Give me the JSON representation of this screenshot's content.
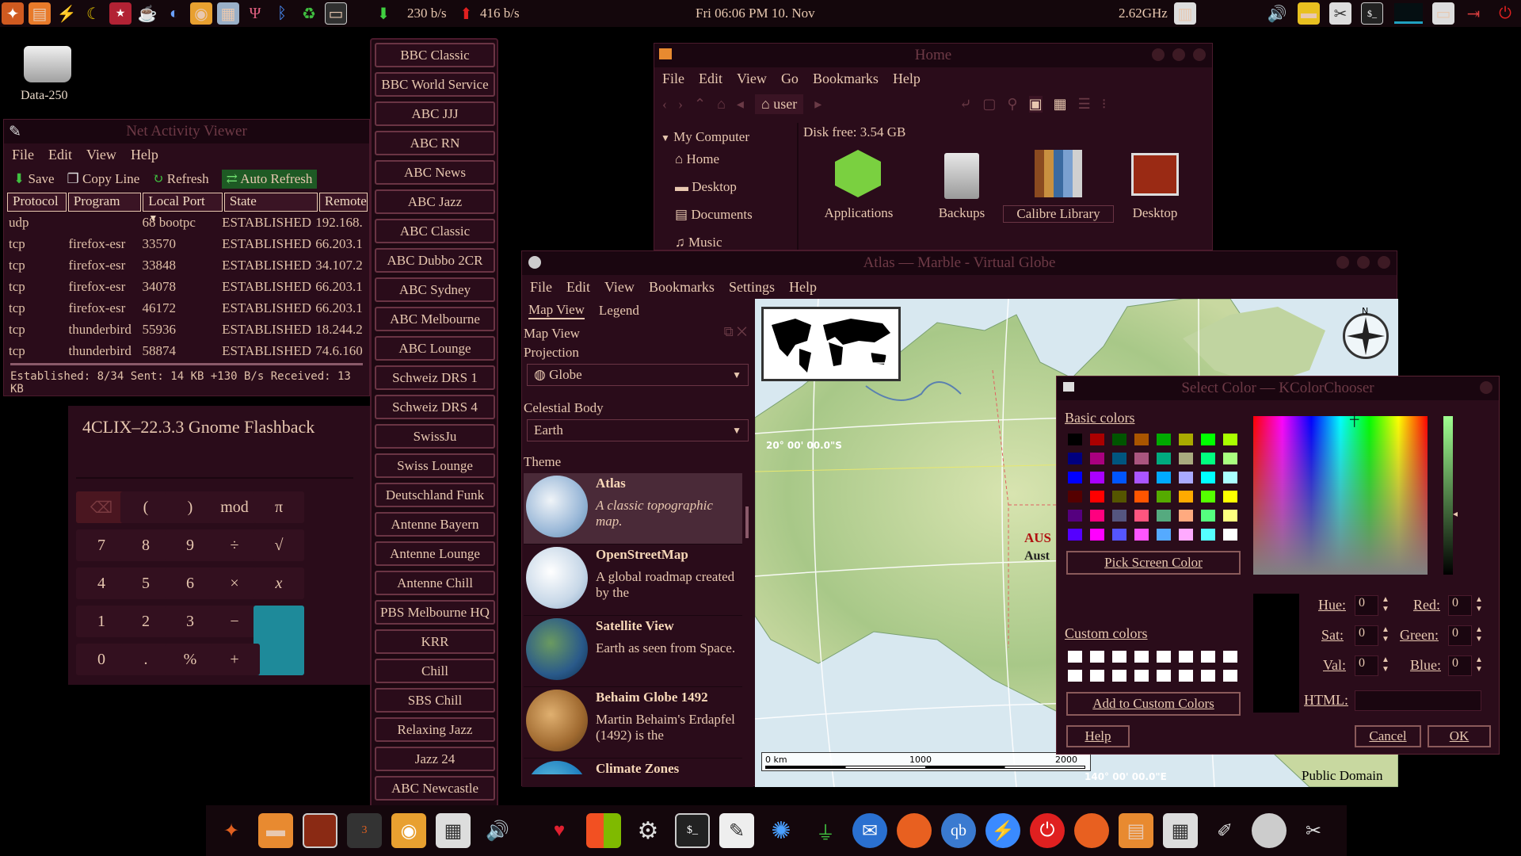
{
  "panel": {
    "net_down": "230 b/s",
    "net_up": "416 b/s",
    "clock": "Fri   06:06 PM  10. Nov",
    "cpu_freq": "2.62GHz"
  },
  "desktop": {
    "drive_label": "Data-250"
  },
  "net_viewer": {
    "title": "Net Activity Viewer",
    "menu": [
      "File",
      "Edit",
      "View",
      "Help"
    ],
    "toolbar": {
      "save": "Save",
      "copy_line": "Copy Line",
      "refresh": "Refresh",
      "auto_refresh": "Auto Refresh"
    },
    "columns": [
      "Protocol",
      "Program",
      "Local Port",
      "State",
      "Remote"
    ],
    "rows": [
      [
        "udp",
        "",
        "68 bootpc",
        "ESTABLISHED",
        "192.168."
      ],
      [
        "tcp",
        "firefox-esr",
        "33570",
        "ESTABLISHED",
        "66.203.1"
      ],
      [
        "tcp",
        "firefox-esr",
        "33848",
        "ESTABLISHED",
        "34.107.2"
      ],
      [
        "tcp",
        "firefox-esr",
        "34078",
        "ESTABLISHED",
        "66.203.1"
      ],
      [
        "tcp",
        "firefox-esr",
        "46172",
        "ESTABLISHED",
        "66.203.1"
      ],
      [
        "tcp",
        "thunderbird",
        "55936",
        "ESTABLISHED",
        "18.244.2"
      ],
      [
        "tcp",
        "thunderbird",
        "58874",
        "ESTABLISHED",
        "74.6.160"
      ]
    ],
    "status": "Established: 8/34  Sent: 14 KB +130 B/s    Received: 13 KB"
  },
  "calculator": {
    "display": "4CLIX–22.3.3 Gnome Flashback",
    "keys": [
      [
        "⌫",
        "(",
        ")",
        "mod",
        "π"
      ],
      [
        "7",
        "8",
        "9",
        "÷",
        "√"
      ],
      [
        "4",
        "5",
        "6",
        "×",
        "x"
      ],
      [
        "1",
        "2",
        "3",
        "−",
        "="
      ],
      [
        "0",
        ".",
        "%",
        "+"
      ]
    ]
  },
  "radio_stations": [
    "BBC Classic",
    "BBC World Service",
    "ABC JJJ",
    "ABC RN",
    "ABC News",
    "ABC Jazz",
    "ABC Classic",
    "ABC Dubbo 2CR",
    "ABC Sydney",
    "ABC Melbourne",
    "ABC Lounge",
    "Schweiz DRS 1",
    "Schweiz DRS 4",
    "SwissJu",
    "Swiss Lounge",
    "Deutschland Funk",
    "Antenne Bayern",
    "Antenne Lounge",
    "Antenne Chill",
    "PBS Melbourne HQ",
    "KRR",
    "Chill",
    "SBS Chill",
    "Relaxing Jazz",
    "Jazz 24",
    "ABC Newcastle"
  ],
  "home": {
    "title": "Home",
    "menu": [
      "File",
      "Edit",
      "View",
      "Go",
      "Bookmarks",
      "Help"
    ],
    "location": "user",
    "sidebar_header": "My Computer",
    "sidebar": [
      "Home",
      "Desktop",
      "Documents",
      "Music"
    ],
    "disk_free": "Disk free: 3.54 GB",
    "items": [
      "Applications",
      "Backups",
      "Calibre Library",
      "Desktop"
    ]
  },
  "marble": {
    "title": "Atlas — Marble - Virtual Globe",
    "menu": [
      "File",
      "Edit",
      "View",
      "Bookmarks",
      "Settings",
      "Help"
    ],
    "tabs": [
      "Map View",
      "Legend"
    ],
    "panel_title": "Map View",
    "projection_label": "Projection",
    "projection_value": "Globe",
    "body_label": "Celestial Body",
    "body_value": "Earth",
    "theme_label": "Theme",
    "themes": [
      {
        "name": "Atlas",
        "desc": "A classic topographic map."
      },
      {
        "name": "OpenStreetMap",
        "desc": "A global roadmap created by the"
      },
      {
        "name": "Satellite View",
        "desc": "Earth as seen from Space."
      },
      {
        "name": "Behaim Globe 1492",
        "desc": "Martin Behaim's Erdapfel (1492) is the"
      },
      {
        "name": "Climate Zones",
        "desc": ""
      }
    ],
    "lat_label": "20° 00' 00.0\"S",
    "lon_label": "140° 00' 00.0\"E",
    "place_label": "AUS",
    "place_label2": "Aust",
    "scale": [
      "0 km",
      "1000",
      "2000"
    ],
    "license": "Public Domain",
    "compass_n": "N"
  },
  "kcolor": {
    "title": "Select Color — KColorChooser",
    "basic_label": "Basic colors",
    "custom_label": "Custom colors",
    "pick_screen": "Pick Screen Color",
    "add_custom": "Add to Custom Colors",
    "help": "Help",
    "cancel": "Cancel",
    "ok": "OK",
    "hue_label": "Hue:",
    "sat_label": "Sat:",
    "val_label": "Val:",
    "red_label": "Red:",
    "green_label": "Green:",
    "blue_label": "Blue:",
    "html_label": "HTML:",
    "hue": "0",
    "sat": "0",
    "val": "0",
    "red": "0",
    "green": "0",
    "blue": "0",
    "basic_colors": [
      "#000000",
      "#aa0000",
      "#005500",
      "#aa5500",
      "#00aa00",
      "#aaaa00",
      "#00ff00",
      "#aaff00",
      "#00007f",
      "#aa007f",
      "#00557f",
      "#aa557f",
      "#00aa7f",
      "#aaaa7f",
      "#00ff7f",
      "#aaff7f",
      "#0000ff",
      "#aa00ff",
      "#0055ff",
      "#aa55ff",
      "#00aaff",
      "#aaaaff",
      "#00ffff",
      "#aaffff",
      "#550000",
      "#ff0000",
      "#555500",
      "#ff5500",
      "#55aa00",
      "#ffaa00",
      "#55ff00",
      "#ffff00",
      "#55007f",
      "#ff007f",
      "#55557f",
      "#ff557f",
      "#55aa7f",
      "#ffaa7f",
      "#55ff7f",
      "#ffff7f",
      "#5500ff",
      "#ff00ff",
      "#5555ff",
      "#ff55ff",
      "#55aaff",
      "#ffaaff",
      "#55ffff",
      "#ffffff"
    ]
  },
  "dock": {
    "badge": "3"
  }
}
